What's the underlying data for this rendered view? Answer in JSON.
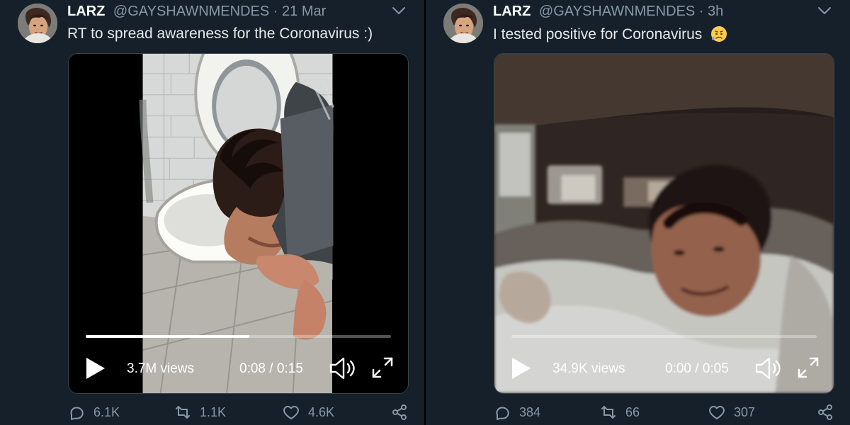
{
  "tweets": [
    {
      "name": "LARZ",
      "handle": "@GAYSHAWNMENDES",
      "separator": "·",
      "time": "21 Mar",
      "text": "RT to spread awareness for the Coronavirus :)",
      "video": {
        "views": "3.7M views",
        "duration": "0:08 / 0:15",
        "progress": 0.535
      },
      "stats": {
        "replies": "6.1K",
        "retweets": "1.1K",
        "likes": "4.6K"
      }
    },
    {
      "name": "LARZ",
      "handle": "@GAYSHAWNMENDES",
      "separator": "·",
      "time": "3h",
      "text": "I tested positive for Coronavirus",
      "emoji": "sad-sweat-emoji",
      "video": {
        "views": "34.9K views",
        "duration": "0:00 / 0:05",
        "progress": 0
      },
      "stats": {
        "replies": "384",
        "retweets": "66",
        "likes": "307"
      }
    }
  ],
  "icons": {
    "chevron": "chevron-down-icon",
    "play": "play-icon",
    "volume": "volume-icon",
    "fullscreen": "fullscreen-icon",
    "reply": "reply-icon",
    "retweet": "retweet-icon",
    "like": "heart-icon",
    "share": "share-icon"
  },
  "colors": {
    "background": "#15202b",
    "muted_text": "#8899a6",
    "border": "#38444d",
    "white": "#ffffff"
  }
}
